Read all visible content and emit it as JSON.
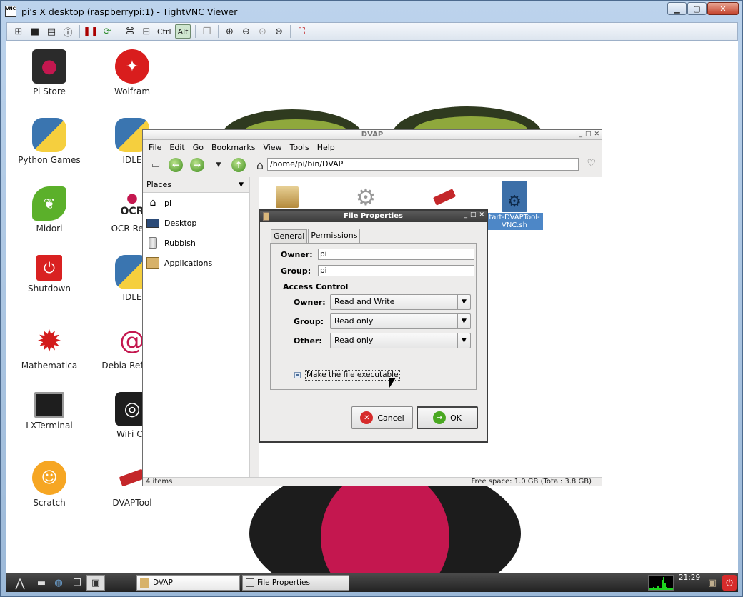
{
  "vnc": {
    "icon_text": "VNC",
    "title": "pi's X desktop (raspberrypi:1) - TightVNC Viewer",
    "toolbar": {
      "ctrl_label": "Ctrl",
      "alt_label": "Alt"
    }
  },
  "desktop": {
    "icons": [
      {
        "label": "Pi Store",
        "icon": "pi-store-icon"
      },
      {
        "label": "Wolfram",
        "icon": "wolfram-icon"
      },
      {
        "label": "Python Games",
        "icon": "python-icon"
      },
      {
        "label": "IDLE",
        "icon": "python-icon"
      },
      {
        "label": "Midori",
        "icon": "midori-icon"
      },
      {
        "label": "OCR Reso",
        "icon": "ocr-icon"
      },
      {
        "label": "Shutdown",
        "icon": "power-icon"
      },
      {
        "label": "IDLE",
        "icon": "python-icon"
      },
      {
        "label": "Mathematica",
        "icon": "mathematica-icon"
      },
      {
        "label": "Debia Referen",
        "icon": "debian-icon"
      },
      {
        "label": "LXTerminal",
        "icon": "monitor-icon"
      },
      {
        "label": "WiFi Co",
        "icon": "wifi-icon"
      },
      {
        "label": "Scratch",
        "icon": "scratch-cat-icon"
      },
      {
        "label": "DVAPTool",
        "icon": "usb-dongle-icon"
      }
    ]
  },
  "fm": {
    "title": "DVAP",
    "menu": [
      "File",
      "Edit",
      "Go",
      "Bookmarks",
      "View",
      "Tools",
      "Help"
    ],
    "path": "/home/pi/bin/DVAP",
    "places_label": "Places",
    "places": [
      {
        "label": "pi",
        "icon": "home-icon"
      },
      {
        "label": "Desktop",
        "icon": "desktop-icon"
      },
      {
        "label": "Rubbish",
        "icon": "trash-icon"
      },
      {
        "label": "Applications",
        "icon": "applications-icon"
      }
    ],
    "files": [
      {
        "label": "",
        "icon": "package-icon"
      },
      {
        "label": "",
        "icon": "gear-icon"
      },
      {
        "label": "",
        "icon": "usb-dongle-icon"
      },
      {
        "label": "tart-DVAPTool-VNC.sh",
        "icon": "script-icon"
      }
    ],
    "status_left": "4 items",
    "status_right": "Free space: 1.0 GB (Total: 3.8 GB)"
  },
  "dialog": {
    "title": "File Properties",
    "tabs": [
      "General",
      "Permissions"
    ],
    "owner_label": "Owner:",
    "owner_value": "pi",
    "group_label": "Group:",
    "group_value": "pi",
    "access_heading": "Access Control",
    "access": [
      {
        "label": "Owner:",
        "value": "Read and Write"
      },
      {
        "label": "Group:",
        "value": "Read only"
      },
      {
        "label": "Other:",
        "value": "Read only"
      }
    ],
    "executable_label": "Make the file executable",
    "executable_checked": false,
    "cancel_label": "Cancel",
    "ok_label": "OK"
  },
  "taskbar": {
    "tasks": [
      "DVAP",
      "File Properties"
    ],
    "clock": "21:29"
  },
  "colors": {
    "accent": "#4d87c7",
    "raspberry": "#c4174f",
    "leaf": "#8fa83c"
  }
}
